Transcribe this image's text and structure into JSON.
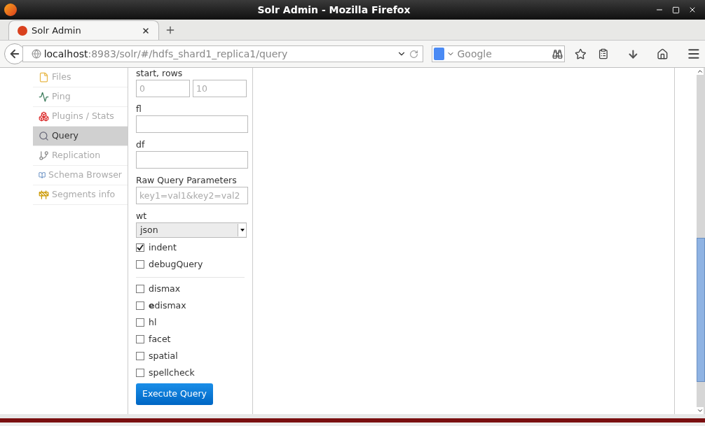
{
  "window": {
    "title": "Solr Admin - Mozilla Firefox"
  },
  "tabs": [
    {
      "label": "Solr Admin",
      "selected": true
    }
  ],
  "url": {
    "host": "localhost",
    "rest": ":8983/solr/#/hdfs_shard1_replica1/query"
  },
  "search": {
    "placeholder": "Google"
  },
  "sidebar": {
    "items": [
      {
        "label": "Files",
        "selected": false
      },
      {
        "label": "Ping",
        "selected": false
      },
      {
        "label": "Plugins / Stats",
        "selected": false
      },
      {
        "label": "Query",
        "selected": true
      },
      {
        "label": "Replication",
        "selected": false
      },
      {
        "label": "Schema Browser",
        "selected": false
      },
      {
        "label": "Segments info",
        "selected": false
      }
    ]
  },
  "form": {
    "start_rows": {
      "label": "start, rows",
      "start_placeholder": "0",
      "rows_placeholder": "10"
    },
    "fields": [
      {
        "label": "fl"
      },
      {
        "label": "df"
      },
      {
        "label": "Raw Query Parameters",
        "placeholder": "key1=val1&key2=val2"
      }
    ],
    "wt": {
      "label": "wt",
      "value": "json"
    },
    "options": [
      {
        "label": "indent",
        "checked": true
      },
      {
        "label": "debugQuery",
        "checked": false
      }
    ],
    "parsers": [
      {
        "label": "dismax",
        "checked": false
      },
      {
        "label": "**e**dismax",
        "checked": false
      },
      {
        "label": "hl",
        "checked": false
      },
      {
        "label": "facet",
        "checked": false
      },
      {
        "label": "spatial",
        "checked": false
      },
      {
        "label": "spellcheck",
        "checked": false
      }
    ],
    "submit": "Execute Query"
  }
}
